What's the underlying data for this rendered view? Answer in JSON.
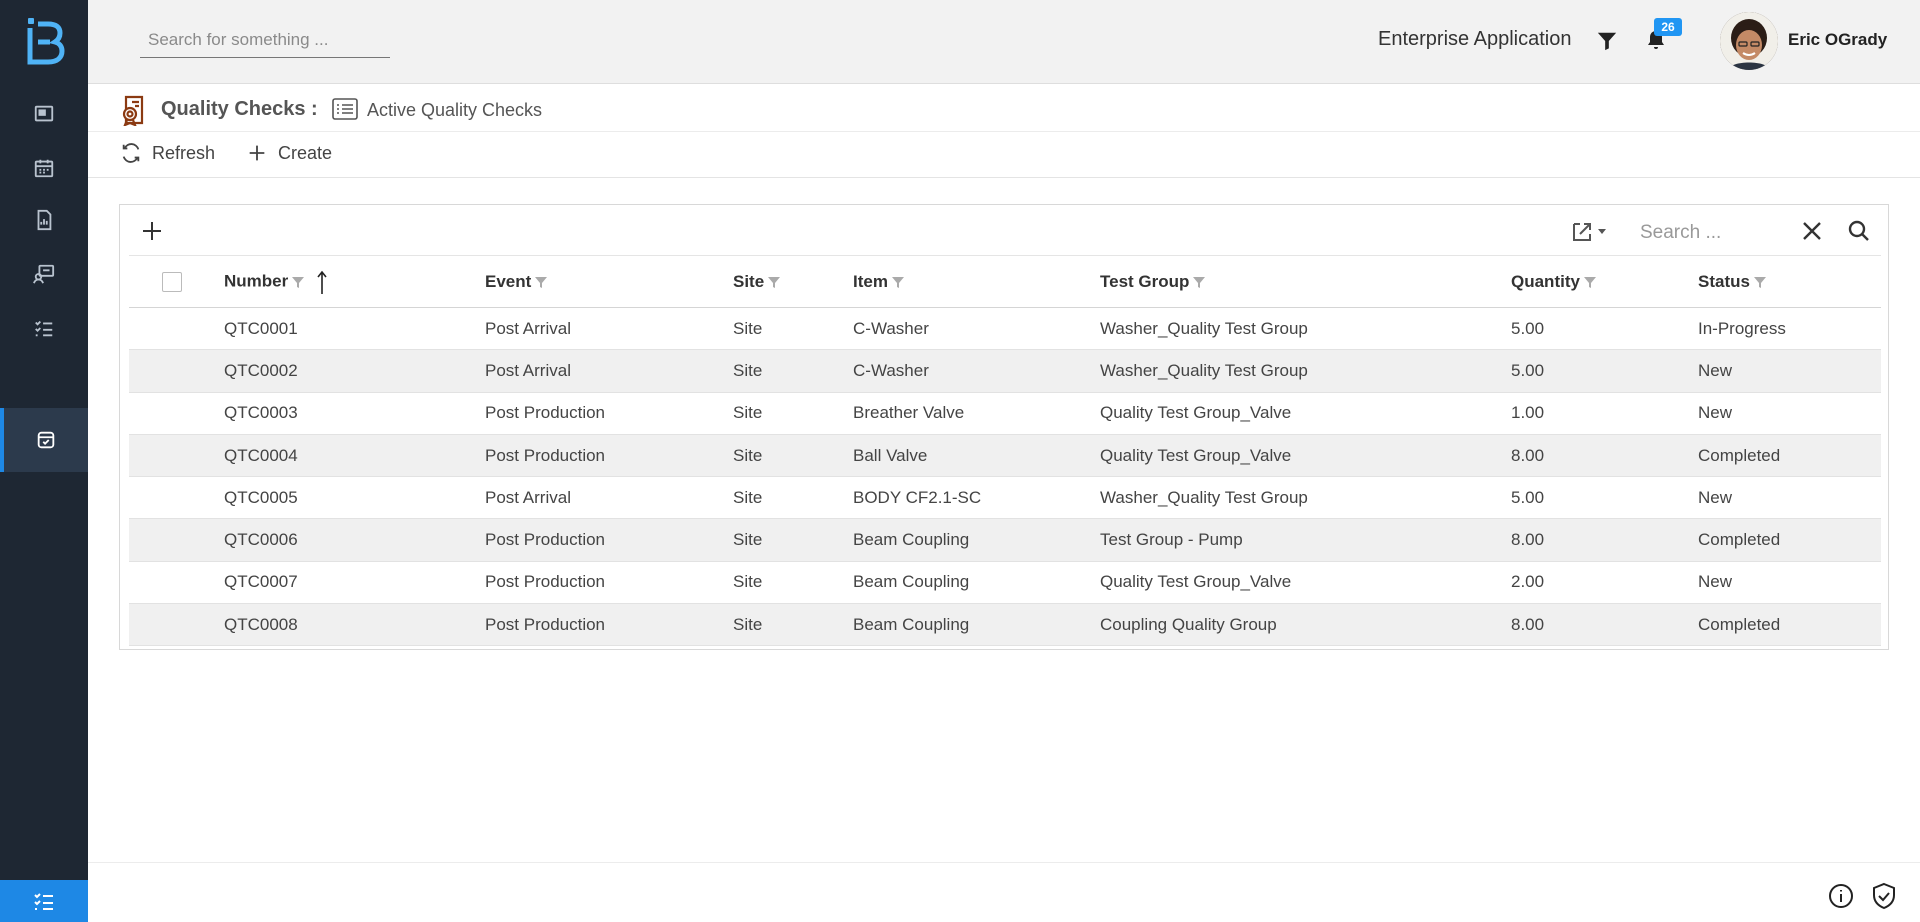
{
  "topbar": {
    "search_placeholder": "Search for something ...",
    "app_name": "Enterprise Application",
    "notification_count": "26",
    "user_name": "Eric OGrady"
  },
  "page": {
    "module_title": "Quality Checks :",
    "view_title": "Active Quality Checks"
  },
  "actions": {
    "refresh_label": "Refresh",
    "create_label": "Create"
  },
  "grid": {
    "search_placeholder": "Search ...",
    "columns": [
      "Number",
      "Event",
      "Site",
      "Item",
      "Test Group",
      "Quantity",
      "Status"
    ],
    "rows": [
      {
        "number": "QTC0001",
        "event": "Post Arrival",
        "site": "Site",
        "item": "C-Washer",
        "test_group": "Washer_Quality Test Group",
        "quantity": "5.00",
        "status": "In-Progress"
      },
      {
        "number": "QTC0002",
        "event": "Post Arrival",
        "site": "Site",
        "item": "C-Washer",
        "test_group": "Washer_Quality Test Group",
        "quantity": "5.00",
        "status": "New"
      },
      {
        "number": "QTC0003",
        "event": "Post Production",
        "site": "Site",
        "item": "Breather Valve",
        "test_group": "Quality Test Group_Valve",
        "quantity": "1.00",
        "status": "New"
      },
      {
        "number": "QTC0004",
        "event": "Post Production",
        "site": "Site",
        "item": "Ball Valve",
        "test_group": "Quality Test Group_Valve",
        "quantity": "8.00",
        "status": "Completed"
      },
      {
        "number": "QTC0005",
        "event": "Post Arrival",
        "site": "Site",
        "item": "BODY CF2.1-SC",
        "test_group": "Washer_Quality Test Group",
        "quantity": "5.00",
        "status": "New"
      },
      {
        "number": "QTC0006",
        "event": "Post Production",
        "site": "Site",
        "item": "Beam Coupling",
        "test_group": "Test Group - Pump",
        "quantity": "8.00",
        "status": "Completed"
      },
      {
        "number": "QTC0007",
        "event": "Post Production",
        "site": "Site",
        "item": "Beam Coupling",
        "test_group": "Quality Test Group_Valve",
        "quantity": "2.00",
        "status": "New"
      },
      {
        "number": "QTC0008",
        "event": "Post Production",
        "site": "Site",
        "item": "Beam Coupling",
        "test_group": "Coupling Quality Group",
        "quantity": "8.00",
        "status": "Completed"
      }
    ]
  },
  "colors": {
    "sidebar_bg": "#1e2733",
    "accent": "#1e88e5",
    "link": "#2b6cb0",
    "brand_icon": "#8b3a12"
  },
  "icons": {
    "sidebar": [
      "dashboard-icon",
      "calendar-icon",
      "report-icon",
      "monitor-icon",
      "checklist-icon",
      "quality-check-icon"
    ],
    "bottom": "list-check-icon"
  }
}
